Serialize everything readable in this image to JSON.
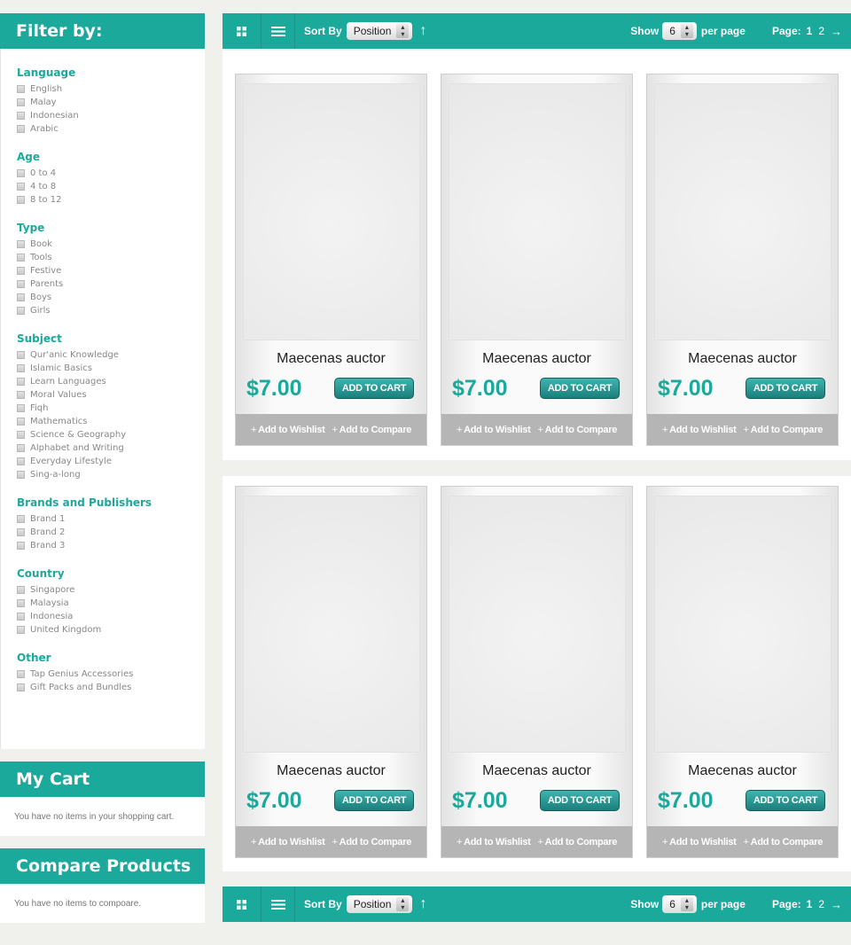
{
  "sidebar": {
    "filter_title": "Filter by:",
    "groups": [
      {
        "title": "Language",
        "options": [
          "English",
          "Malay",
          "Indonesian",
          "Arabic"
        ]
      },
      {
        "title": "Age",
        "options": [
          "0 to 4",
          "4 to 8",
          "8 to 12"
        ]
      },
      {
        "title": "Type",
        "options": [
          "Book",
          "Tools",
          "Festive",
          "Parents",
          "Boys",
          "Girls"
        ]
      },
      {
        "title": "Subject",
        "options": [
          "Qur'anic Knowledge",
          "Islamic Basics",
          "Learn Languages",
          "Moral Values",
          "Fiqh",
          "Mathematics",
          "Science & Geography",
          "Alphabet and Writing",
          "Everyday Lifestyle",
          "Sing-a-long"
        ]
      },
      {
        "title": "Brands and Publishers",
        "options": [
          "Brand 1",
          "Brand 2",
          "Brand 3"
        ]
      },
      {
        "title": "Country",
        "options": [
          "Singapore",
          "Malaysia",
          "Indonesia",
          "United Kingdom"
        ]
      },
      {
        "title": "Other",
        "options": [
          "Tap Genius Accessories",
          "Gift Packs and Bundles"
        ]
      }
    ],
    "cart_title": "My Cart",
    "cart_empty": "You have no items in your shopping cart.",
    "compare_title": "Compare Products",
    "compare_empty": "You have no items to compoare."
  },
  "toolbar": {
    "sort_label": "Sort By",
    "sort_value": "Position",
    "show_label": "Show",
    "show_value": "6",
    "per_page_label": "per page",
    "page_label": "Page:",
    "current_page": "1",
    "next_page": "2",
    "grid_icon": "grid-view-icon",
    "list_icon": "list-view-icon",
    "sort_dir_icon": "arrow-up-icon",
    "next_icon": "arrow-right-icon"
  },
  "products": [
    {
      "name": "Maecenas auctor",
      "price": "$7.00",
      "cart_label": "ADD TO CART",
      "wishlist_label": "Add to Wishlist",
      "compare_label": "Add to Compare"
    },
    {
      "name": "Maecenas auctor",
      "price": "$7.00",
      "cart_label": "ADD TO CART",
      "wishlist_label": "Add to Wishlist",
      "compare_label": "Add to Compare"
    },
    {
      "name": "Maecenas auctor",
      "price": "$7.00",
      "cart_label": "ADD TO CART",
      "wishlist_label": "Add to Wishlist",
      "compare_label": "Add to Compare"
    },
    {
      "name": "Maecenas auctor",
      "price": "$7.00",
      "cart_label": "ADD TO CART",
      "wishlist_label": "Add to Wishlist",
      "compare_label": "Add to Compare"
    },
    {
      "name": "Maecenas auctor",
      "price": "$7.00",
      "cart_label": "ADD TO CART",
      "wishlist_label": "Add to Wishlist",
      "compare_label": "Add to Compare"
    },
    {
      "name": "Maecenas auctor",
      "price": "$7.00",
      "cart_label": "ADD TO CART",
      "wishlist_label": "Add to Wishlist",
      "compare_label": "Add to Compare"
    }
  ],
  "colors": {
    "accent": "#1ba99c",
    "footer_grey": "#b5b5b5"
  }
}
